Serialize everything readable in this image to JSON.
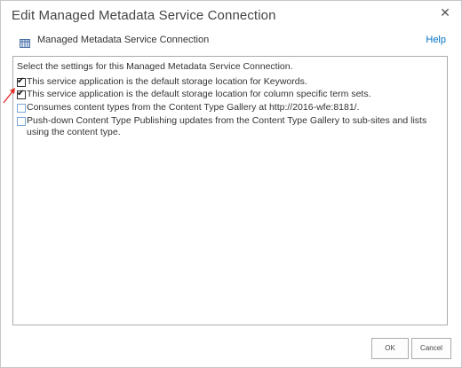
{
  "dialog": {
    "title": "Edit Managed Metadata Service Connection",
    "close_glyph": "✕"
  },
  "header": {
    "icon": "metadata-service-icon",
    "label": "Managed Metadata Service Connection",
    "help_label": "Help"
  },
  "panel": {
    "intro": "Select the settings for this Managed Metadata Service Connection.",
    "options": [
      {
        "label": "This service application is the default storage location for Keywords.",
        "checked": true
      },
      {
        "label": "This service application is the default storage location for column specific term sets.",
        "checked": true
      },
      {
        "label": "Consumes content types from the Content Type Gallery at http://2016-wfe:8181/.",
        "checked": false
      },
      {
        "label": "Push-down Content Type Publishing updates from the Content Type Gallery to sub-sites and lists using the content type.",
        "checked": false
      }
    ]
  },
  "buttons": {
    "ok_label": "OK",
    "cancel_label": "Cancel"
  },
  "colors": {
    "link": "#0072c6",
    "annotation_arrow": "#e0302a"
  }
}
